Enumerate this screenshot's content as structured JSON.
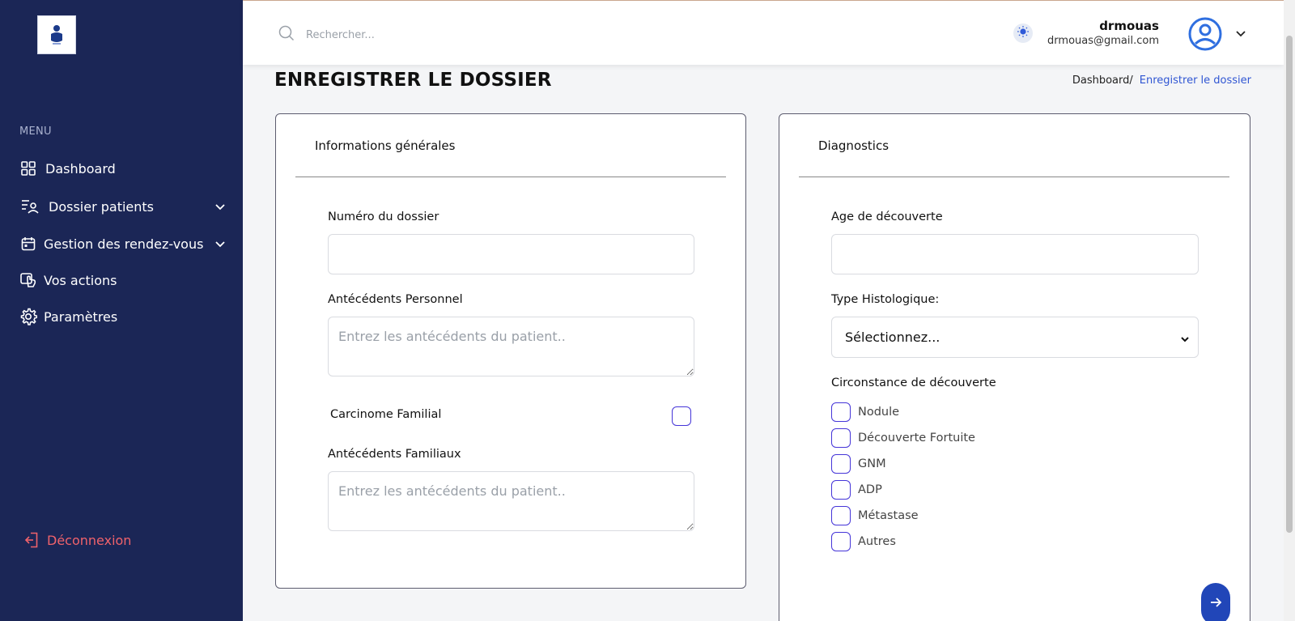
{
  "sidebar": {
    "logo_icon": "clinic-logo",
    "menu_title": "MENU",
    "items": [
      {
        "label": "Dashboard",
        "icon": "grid-icon"
      },
      {
        "label": "Dossier patients",
        "icon": "patient-list-icon",
        "has_submenu": true
      },
      {
        "label": "Gestion des rendez-vous",
        "icon": "calendar-icon",
        "has_submenu": true
      },
      {
        "label": "Vos actions",
        "icon": "actions-icon"
      },
      {
        "label": "Paramètres",
        "icon": "gear-icon"
      }
    ],
    "logout_label": "Déconnexion",
    "colors": {
      "background": "#1b2656",
      "logout": "#f0626b"
    }
  },
  "header": {
    "search_placeholder": "Rechercher...",
    "user": {
      "name": "drmouas",
      "email": "drmouas@gmail.com"
    }
  },
  "page": {
    "title": "ENREGISTRER LE DOSSIER",
    "breadcrumb": {
      "home": "Dashboard/",
      "current": "Enregistrer le dossier"
    }
  },
  "general_card": {
    "title": "Informations générales",
    "numero_label": "Numéro du dossier",
    "numero_value": "",
    "antecedents_perso_label": "Antécédents Personnel",
    "antecedents_perso_placeholder": "Entrez les antécédents du patient..",
    "carcinome_label": "Carcinome Familial",
    "carcinome_checked": false,
    "antecedents_fam_label": "Antécédents Familiaux",
    "antecedents_fam_placeholder": "Entrez les antécédents du patient.."
  },
  "diagnostics_card": {
    "title": "Diagnostics",
    "age_label": "Age de découverte",
    "age_value": "",
    "type_label": "Type Histologique:",
    "type_selected": "Sélectionnez...",
    "circonstance_label": "Circonstance de découverte",
    "options": [
      {
        "label": "Nodule",
        "checked": false
      },
      {
        "label": "Découverte Fortuite",
        "checked": false
      },
      {
        "label": "GNM",
        "checked": false
      },
      {
        "label": "ADP",
        "checked": false
      },
      {
        "label": "Métastase",
        "checked": false
      },
      {
        "label": "Autres",
        "checked": false
      }
    ]
  },
  "next_button_icon": "arrow-right-icon",
  "colors": {
    "accent": "#3056d3",
    "checkbox_border": "#4535d8",
    "next_button": "#2146b8"
  }
}
